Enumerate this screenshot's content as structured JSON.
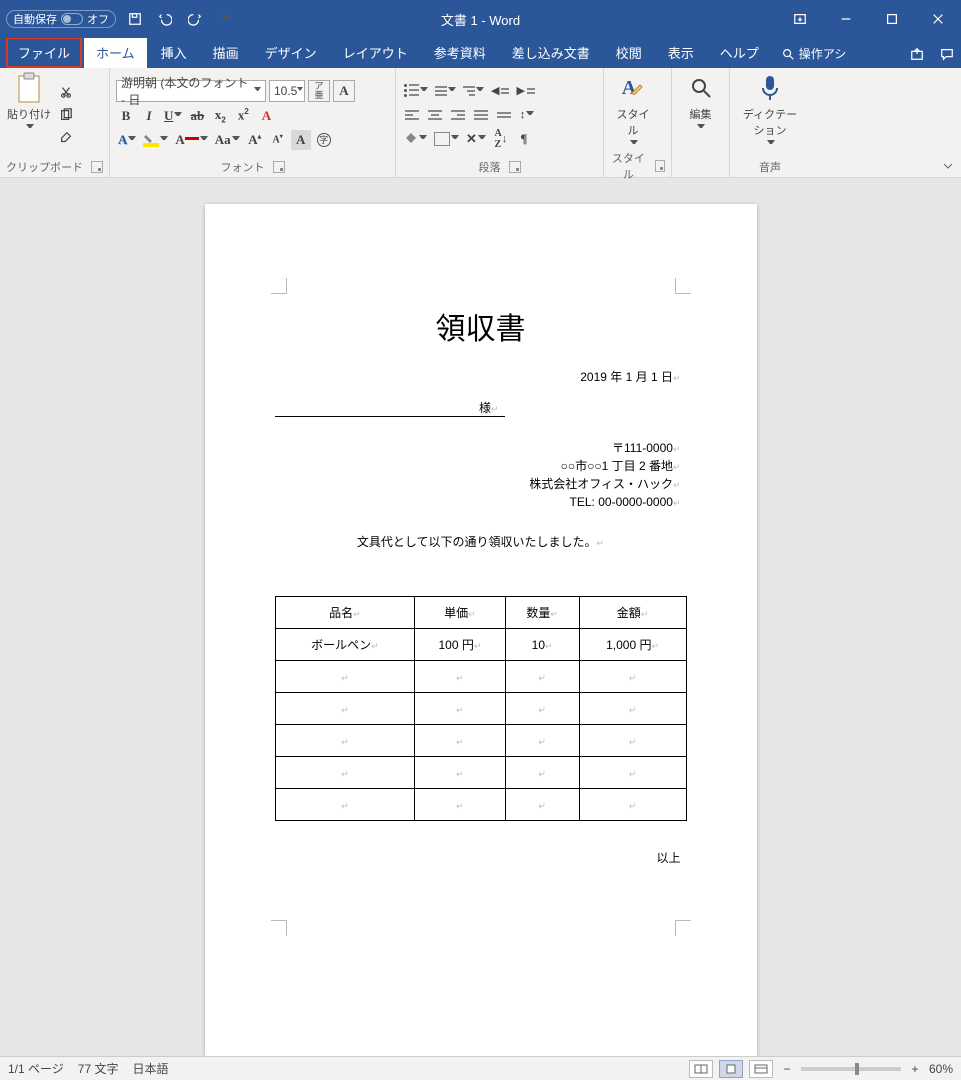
{
  "titlebar": {
    "autosave_label": "自動保存",
    "autosave_state": "オフ",
    "title": "文書 1  -  Word"
  },
  "tabs": {
    "file": "ファイル",
    "home": "ホーム",
    "insert": "挿入",
    "draw": "描画",
    "design": "デザイン",
    "layout": "レイアウト",
    "references": "参考資料",
    "mailings": "差し込み文書",
    "review": "校閲",
    "view": "表示",
    "help": "ヘルプ",
    "tellme": "操作アシ"
  },
  "ribbon": {
    "clipboard": {
      "paste": "貼り付け",
      "group": "クリップボード"
    },
    "font": {
      "name": "游明朝 (本文のフォント - 日",
      "size": "10.5",
      "group": "フォント",
      "ruby": "ア\n亜"
    },
    "paragraph": {
      "group": "段落"
    },
    "styles": {
      "label": "スタイ\nル",
      "group": "スタイル"
    },
    "editing": {
      "label": "編集"
    },
    "voice": {
      "label": "ディクテー\nション",
      "group": "音声"
    }
  },
  "document": {
    "title": "領収書",
    "date": "2019 年 1 月 1 日",
    "recipient_suffix": "様",
    "sender": {
      "zip": "〒111-0000",
      "addr": "○○市○○1 丁目 2 番地",
      "company": "株式会社オフィス・ハック",
      "tel": "TEL: 00-0000-0000"
    },
    "body": "文具代として以下の通り領収いたしました。",
    "table": {
      "headers": [
        "品名",
        "単価",
        "数量",
        "金額"
      ],
      "rows": [
        [
          "ボールペン",
          "100 円",
          "10",
          "1,000 円"
        ],
        [
          "",
          "",
          "",
          ""
        ],
        [
          "",
          "",
          "",
          ""
        ],
        [
          "",
          "",
          "",
          ""
        ],
        [
          "",
          "",
          "",
          ""
        ],
        [
          "",
          "",
          "",
          ""
        ]
      ]
    },
    "end": "以上"
  },
  "status": {
    "page": "1/1 ページ",
    "words": "77 文字",
    "lang": "日本語",
    "zoom": "60%"
  }
}
